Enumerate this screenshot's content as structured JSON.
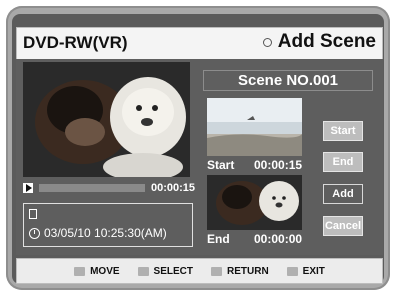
{
  "header": {
    "device": "DVD-RW(VR)",
    "screen_title": "Add Scene"
  },
  "player": {
    "time": "00:00:15",
    "progress": 0.0
  },
  "info": {
    "timestamp": "03/05/10 10:25:30(AM)"
  },
  "scene": {
    "label": "Scene NO.001",
    "start_label": "Start",
    "start_time": "00:00:15",
    "end_label": "End",
    "end_time": "00:00:00"
  },
  "buttons": {
    "start": "Start",
    "end": "End",
    "add": "Add",
    "cancel": "Cancel"
  },
  "footer": {
    "move": "MOVE",
    "select": "SELECT",
    "return": "RETURN",
    "exit": "EXIT"
  }
}
